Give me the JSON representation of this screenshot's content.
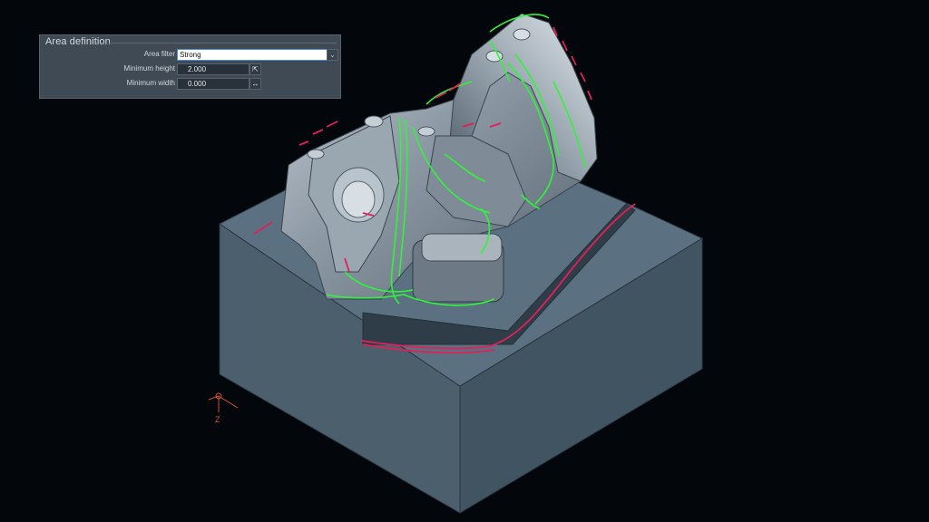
{
  "panel": {
    "title": "Area definition",
    "area_filter": {
      "label": "Area filter",
      "value": "Strong"
    },
    "min_height": {
      "label": "Minimum height",
      "value": "2.000"
    },
    "min_width": {
      "label": "Minimum width",
      "value": "0.000"
    }
  },
  "viewport": {
    "axis_label": "Z"
  },
  "icons": {
    "dropdown": "chevron-down-icon",
    "pick": "cursor-pick-icon",
    "measure": "measure-width-icon"
  },
  "colors": {
    "background": "#03060a",
    "stock": "#4a5e6c",
    "toolpath_green": "#2ef53a",
    "toolpath_red": "#e0205a",
    "axis": "#d05030"
  }
}
